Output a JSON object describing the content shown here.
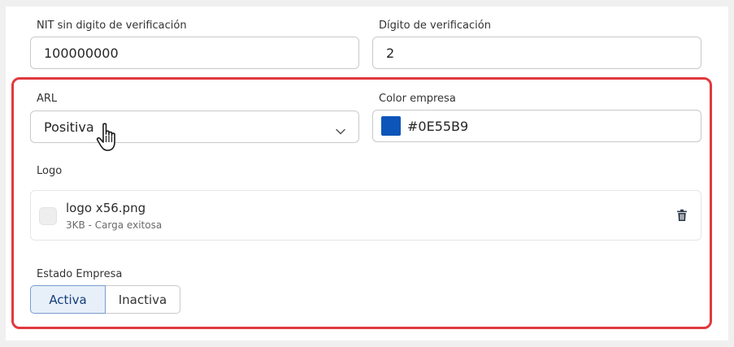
{
  "form": {
    "nit": {
      "label": "NIT sin digito de verificación",
      "value": "100000000"
    },
    "check_digit": {
      "label": "Dígito de verificación",
      "value": "2"
    },
    "arl": {
      "label": "ARL",
      "value": "Positiva"
    },
    "company_color": {
      "label": "Color empresa",
      "value": "#0E55B9",
      "swatch_color": "#0E55B9"
    },
    "logo": {
      "label": "Logo",
      "file_name": "logo x56.png",
      "file_meta": "3KB - Carga exitosa"
    },
    "company_status": {
      "label": "Estado Empresa",
      "options": [
        "Activa",
        "Inactiva"
      ],
      "selected": "Activa"
    }
  },
  "colors": {
    "highlight_border": "#e0393e",
    "active_toggle_bg": "#e7eff9",
    "active_toggle_text": "#153e7a"
  },
  "icons": {
    "select_chevron": "chevron-down-icon",
    "delete": "trash-icon",
    "cursor": "hand-pointer-icon"
  }
}
